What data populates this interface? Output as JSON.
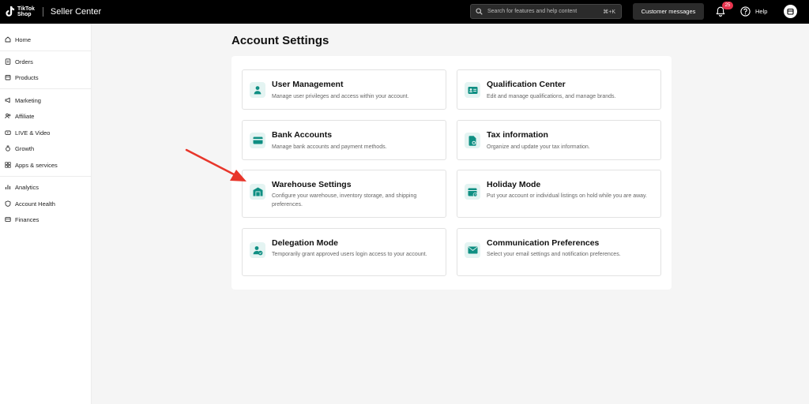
{
  "header": {
    "logo_line1": "TikTok",
    "logo_line2": "Shop",
    "app_title": "Seller Center",
    "search_placeholder": "Search for features and help content",
    "search_shortcut": "⌘+K",
    "customer_messages": "Customer messages",
    "notification_count": "25",
    "help": "Help"
  },
  "sidebar": {
    "items": [
      {
        "label": "Home",
        "icon": "home-icon"
      },
      {
        "label": "Orders",
        "icon": "orders-icon"
      },
      {
        "label": "Products",
        "icon": "products-icon"
      },
      {
        "label": "Marketing",
        "icon": "megaphone-icon"
      },
      {
        "label": "Affiliate",
        "icon": "affiliate-icon"
      },
      {
        "label": "LIVE & Video",
        "icon": "live-icon"
      },
      {
        "label": "Growth",
        "icon": "growth-icon"
      },
      {
        "label": "Apps & services",
        "icon": "apps-icon"
      },
      {
        "label": "Analytics",
        "icon": "analytics-icon"
      },
      {
        "label": "Account Health",
        "icon": "shield-icon"
      },
      {
        "label": "Finances",
        "icon": "wallet-icon"
      }
    ]
  },
  "main": {
    "title": "Account Settings",
    "cards": [
      {
        "title": "User Management",
        "desc": "Manage user privileges and access within your account.",
        "icon": "user-icon"
      },
      {
        "title": "Qualification Center",
        "desc": "Edit and manage qualifications, and manage brands.",
        "icon": "id-card-icon"
      },
      {
        "title": "Bank Accounts",
        "desc": "Manage bank accounts and payment methods.",
        "icon": "bank-card-icon"
      },
      {
        "title": "Tax information",
        "desc": "Organize and update your tax information.",
        "icon": "tax-document-icon"
      },
      {
        "title": "Warehouse Settings",
        "desc": "Configure your warehouse, inventory storage, and shipping preferences.",
        "icon": "warehouse-icon"
      },
      {
        "title": "Holiday Mode",
        "desc": "Put your account or individual listings on hold while you are away.",
        "icon": "calendar-clock-icon"
      },
      {
        "title": "Delegation Mode",
        "desc": "Temporarily grant approved users login access to your account.",
        "icon": "user-check-icon"
      },
      {
        "title": "Communication Preferences",
        "desc": "Select your email settings and notification preferences.",
        "icon": "envelope-icon"
      }
    ]
  },
  "colors": {
    "accent": "#0f8f83",
    "icon_bg": "#e4f4f2",
    "annotation_arrow": "#e8362b",
    "badge": "#e8344e"
  }
}
